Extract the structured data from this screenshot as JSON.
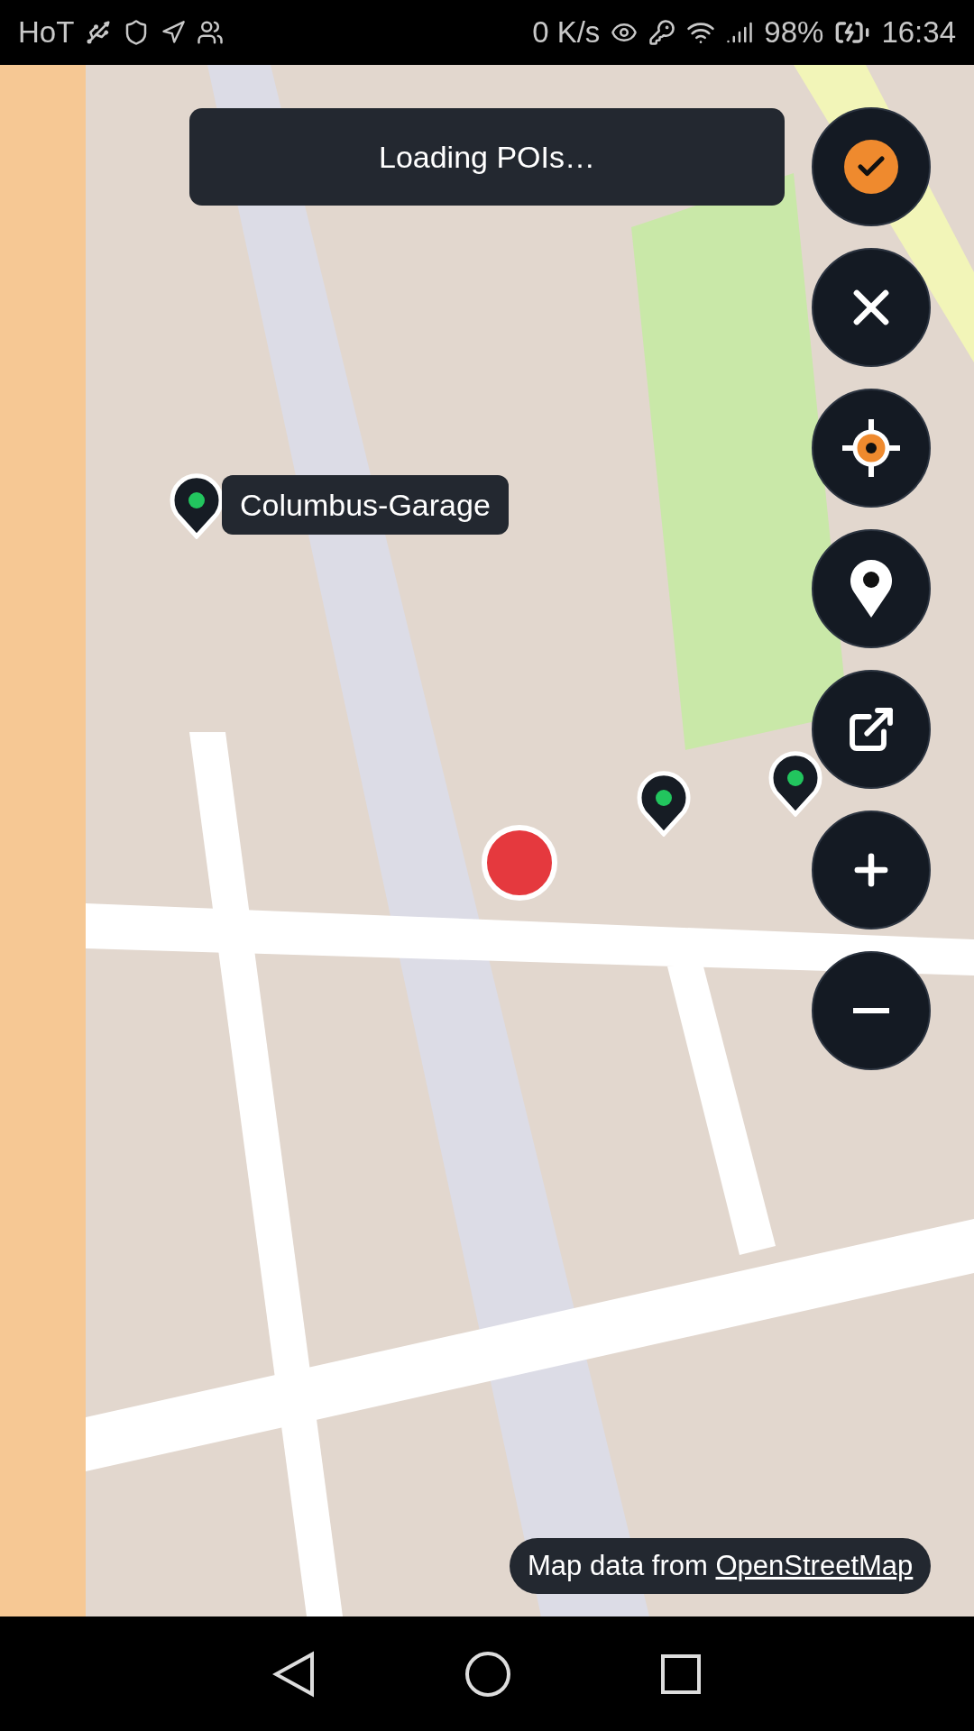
{
  "status_bar": {
    "carrier": "HoT",
    "speed": "0 K/s",
    "battery": "98%",
    "time": "16:34"
  },
  "toast": "Loading POIs…",
  "poi_label": "Columbus-Garage",
  "attribution": {
    "text": "Map data from ",
    "link": "OpenStreetMap"
  }
}
